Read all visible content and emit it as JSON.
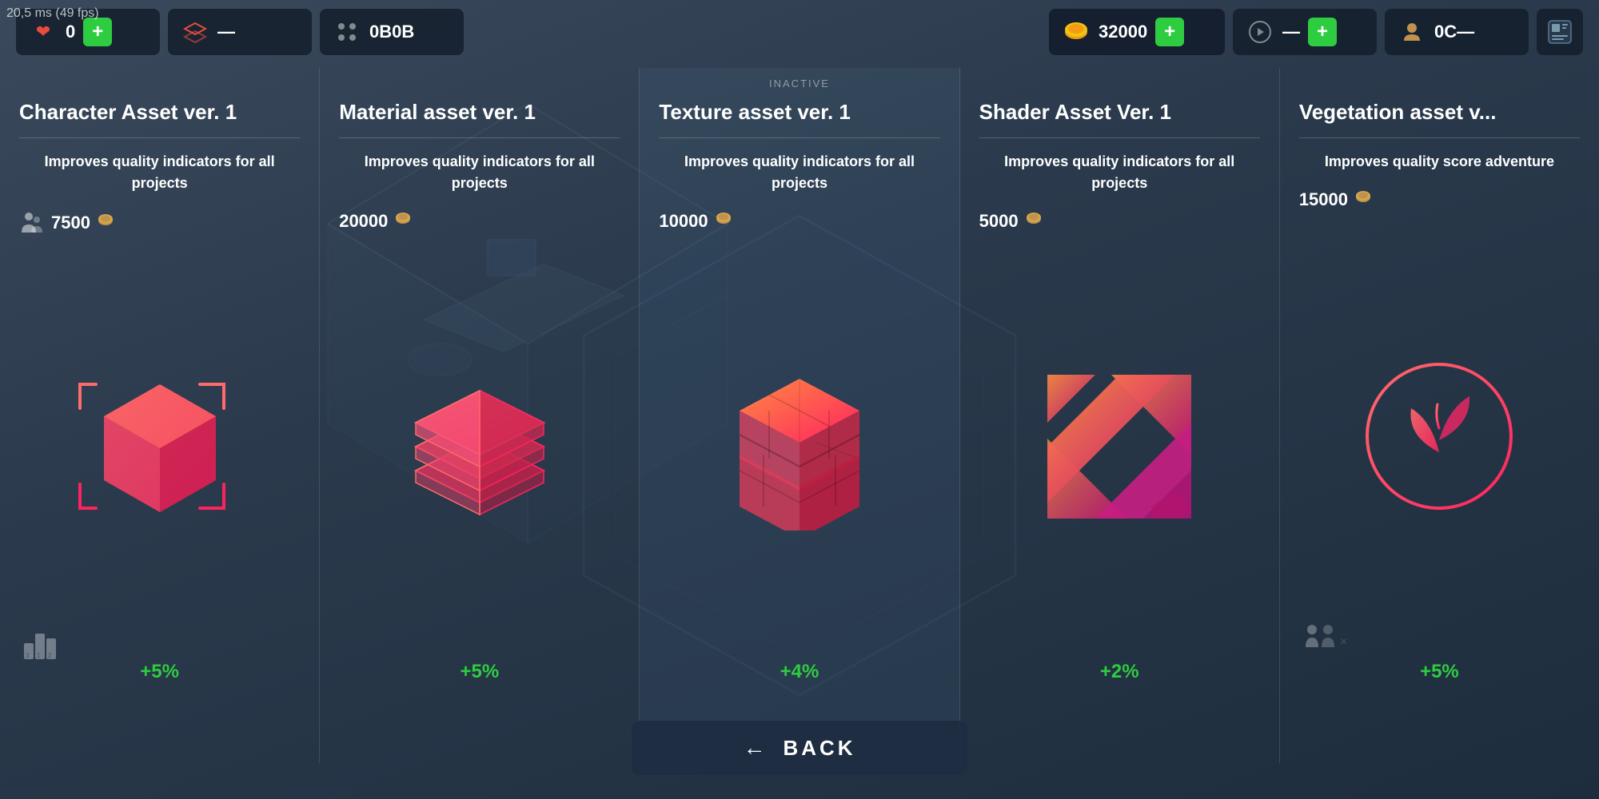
{
  "perf": {
    "label": "20,5 ms (49 fps)"
  },
  "hud": {
    "health_icon": "❤",
    "health_value": "0",
    "layers_icon": "🗂",
    "dots_icon": "⠿",
    "currency_icon": "🪙",
    "currency_value": "32000",
    "add_label": "+",
    "profile_icon": "👤",
    "inactive_label": "INACTIVE"
  },
  "cards": [
    {
      "id": "character-asset",
      "title": "Character Asset ver. 1",
      "description": "Improves quality indicators for all projects",
      "price": "7500",
      "bonus": "+5%",
      "icon_type": "cube",
      "active": false
    },
    {
      "id": "material-asset",
      "title": "Material asset ver. 1",
      "description": "Improves quality indicators for all projects",
      "price": "20000",
      "bonus": "+5%",
      "icon_type": "layers",
      "active": false
    },
    {
      "id": "texture-asset",
      "title": "Texture asset ver. 1",
      "description": "Improves quality indicators for all projects",
      "price": "10000",
      "bonus": "+4%",
      "icon_type": "bricks",
      "active": true
    },
    {
      "id": "shader-asset",
      "title": "Shader Asset Ver. 1",
      "description": "Improves quality indicators for all projects",
      "price": "5000",
      "bonus": "+2%",
      "icon_type": "shader",
      "active": false
    },
    {
      "id": "vegetation-asset",
      "title": "Vegetation asset v...",
      "description": "Improves quality score adventure",
      "price": "15000",
      "bonus": "+5%",
      "icon_type": "plant",
      "active": false
    }
  ],
  "back_button": {
    "label": "BACK",
    "arrow": "←"
  }
}
